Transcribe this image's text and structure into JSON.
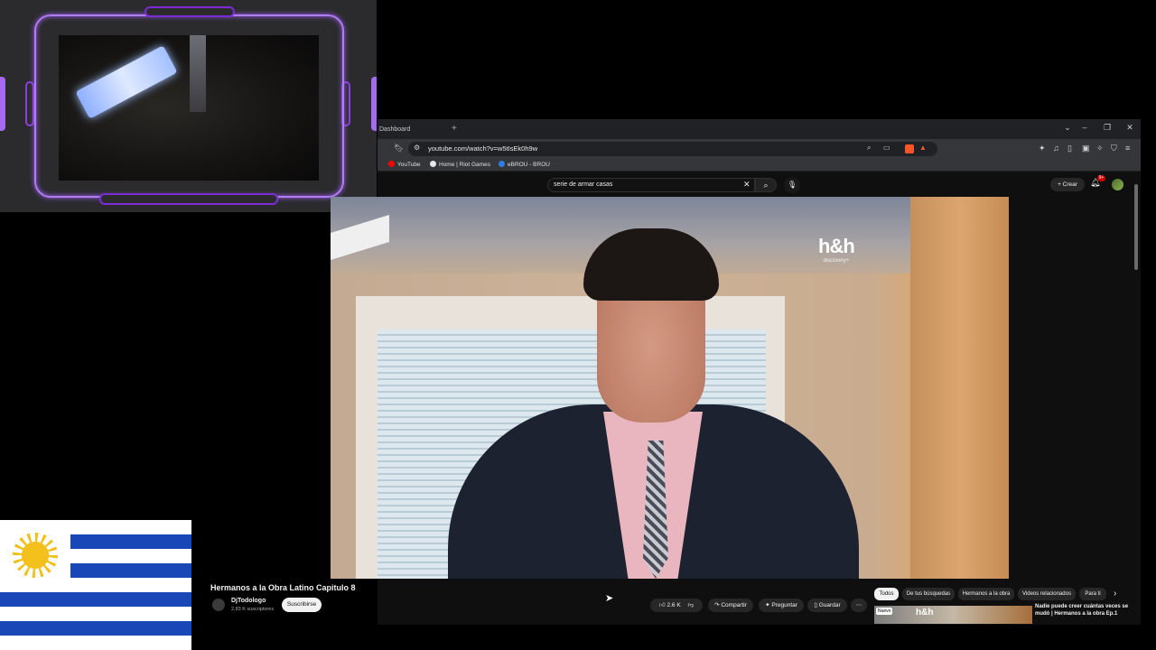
{
  "browser": {
    "tab_title": "Dashboard",
    "new_tab": "+",
    "url": "youtube.com/watch?v=w5tIsEk0h9w",
    "bookmarks": [
      "YouTube",
      "Home | Riot Games",
      "eBROU - BROU"
    ]
  },
  "youtube": {
    "search_value": "serie de armar casas",
    "create_label": "Crear",
    "notification_count": "9+",
    "video": {
      "watermark": "h&h",
      "watermark_sub": "discovery+",
      "title": "Hermanos a la Obra Latino Capitulo 8"
    },
    "channel": {
      "name": "DjTodologo",
      "subscribers": "2,83 K suscriptores",
      "subscribe_label": "Suscribirse"
    },
    "actions": {
      "likes": "2.6 K",
      "share": "Compartir",
      "ask": "Preguntar",
      "save": "Guardar"
    },
    "chips": [
      "Todos",
      "De tus búsquedas",
      "Hermanos a la obra",
      "Videos relacionados",
      "Para ti"
    ],
    "recommendation": {
      "badge": "Nuevo",
      "thumb_logo": "h&h",
      "title": "Nadie puede creer cuántas veces se mudó | Hermanos a la obra Ep.1"
    }
  },
  "icons": [
    "bookmark-icon",
    "site-info-icon",
    "zoom-icon",
    "cast-icon",
    "brave-shield-icon",
    "extensions-icon",
    "music-icon",
    "sidebar-icon",
    "wallet-icon",
    "vpn-icon",
    "menu-icon",
    "clear-icon",
    "search-icon",
    "mic-icon",
    "bell-icon",
    "like-icon",
    "dislike-icon",
    "share-icon",
    "sparkle-icon",
    "save-icon",
    "more-icon",
    "chevron-right-icon"
  ],
  "colors": {
    "youtube_bg": "#0f0f0f",
    "chip_active": "#f1f1f1",
    "overlay_purple": "#9b5cf0",
    "flag_blue": "#1a47b8",
    "flag_sun": "#f4c01c"
  }
}
